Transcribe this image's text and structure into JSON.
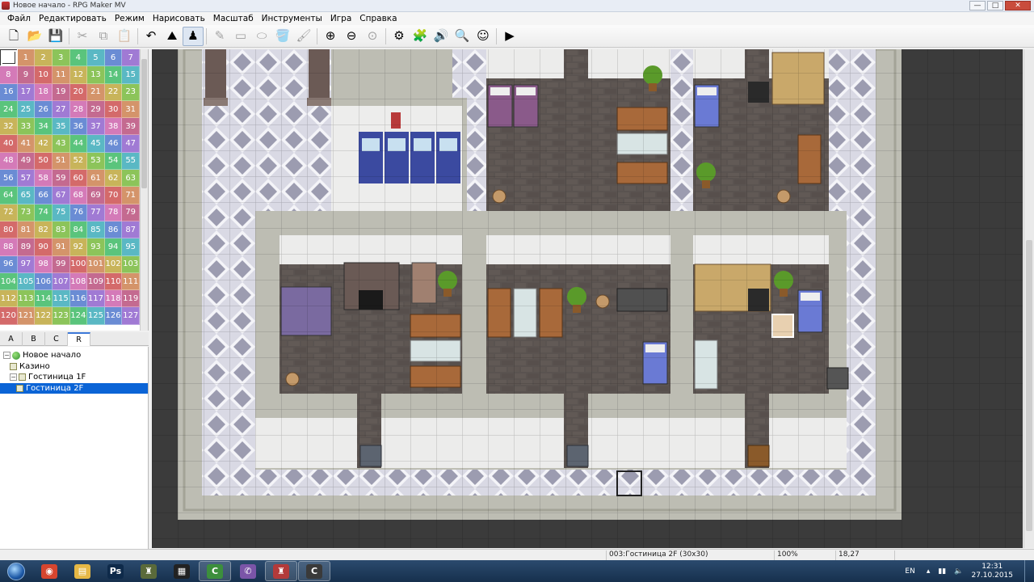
{
  "window": {
    "title": "Новое начало - RPG Maker MV",
    "minimize": "—",
    "maximize": "□",
    "close": "✕"
  },
  "menu": [
    "Файл",
    "Редактировать",
    "Режим",
    "Нарисовать",
    "Масштаб",
    "Инструменты",
    "Игра",
    "Справка"
  ],
  "toolbar": [
    {
      "name": "new-project-icon",
      "glyph": "🗋",
      "state": "normal"
    },
    {
      "name": "open-project-icon",
      "glyph": "📂",
      "state": "normal"
    },
    {
      "name": "save-project-icon",
      "glyph": "💾",
      "state": "normal"
    },
    {
      "sep": true
    },
    {
      "name": "cut-icon",
      "glyph": "✂",
      "state": "disabled"
    },
    {
      "name": "copy-icon",
      "glyph": "⧉",
      "state": "disabled"
    },
    {
      "name": "paste-icon",
      "glyph": "📋",
      "state": "disabled"
    },
    {
      "sep": true
    },
    {
      "name": "undo-icon",
      "glyph": "↶",
      "state": "normal"
    },
    {
      "name": "map-mode-icon",
      "glyph": "⛰",
      "state": "normal"
    },
    {
      "name": "event-mode-icon",
      "glyph": "♟",
      "state": "active"
    },
    {
      "sep": true
    },
    {
      "name": "pencil-icon",
      "glyph": "✎",
      "state": "disabled"
    },
    {
      "name": "rectangle-icon",
      "glyph": "▭",
      "state": "disabled"
    },
    {
      "name": "ellipse-icon",
      "glyph": "⬭",
      "state": "disabled"
    },
    {
      "name": "fill-icon",
      "glyph": "🪣",
      "state": "disabled"
    },
    {
      "name": "shadow-pen-icon",
      "glyph": "🖌",
      "state": "disabled"
    },
    {
      "sep": true
    },
    {
      "name": "zoom-in-icon",
      "glyph": "⊕",
      "state": "normal"
    },
    {
      "name": "zoom-out-icon",
      "glyph": "⊖",
      "state": "normal"
    },
    {
      "name": "actual-size-icon",
      "glyph": "⊙",
      "state": "disabled"
    },
    {
      "sep": true
    },
    {
      "name": "database-icon",
      "glyph": "⚙",
      "state": "normal"
    },
    {
      "name": "plugin-manager-icon",
      "glyph": "🧩",
      "state": "normal"
    },
    {
      "name": "sound-test-icon",
      "glyph": "🔊",
      "state": "normal"
    },
    {
      "name": "event-search-icon",
      "glyph": "🔍",
      "state": "normal"
    },
    {
      "name": "character-generator-icon",
      "glyph": "☺",
      "state": "normal"
    },
    {
      "sep": true
    },
    {
      "name": "playtest-icon",
      "glyph": "▶",
      "state": "normal"
    }
  ],
  "palette": {
    "region_ids": [
      "",
      "1",
      "2",
      "3",
      "4",
      "5",
      "6",
      "7",
      "8",
      "9",
      "10",
      "11",
      "12",
      "13",
      "14",
      "15",
      "16",
      "17",
      "18",
      "19",
      "20",
      "21",
      "22",
      "23",
      "24",
      "25",
      "26",
      "27",
      "28",
      "29",
      "30",
      "31",
      "32",
      "33",
      "34",
      "35",
      "36",
      "37",
      "38",
      "39",
      "40",
      "41",
      "42",
      "43",
      "44",
      "45",
      "46",
      "47",
      "48",
      "49",
      "50",
      "51",
      "52",
      "53",
      "54",
      "55",
      "56",
      "57",
      "58",
      "59",
      "60",
      "61",
      "62",
      "63",
      "64",
      "65",
      "66",
      "67",
      "68",
      "69",
      "70",
      "71",
      "72",
      "73",
      "74",
      "75",
      "76",
      "77",
      "78",
      "79",
      "80",
      "81",
      "82",
      "83",
      "84",
      "85",
      "86",
      "87",
      "88",
      "89",
      "90",
      "91",
      "92",
      "93",
      "94",
      "95",
      "96",
      "97",
      "98",
      "99",
      "100",
      "101",
      "102",
      "103",
      "104",
      "105",
      "106",
      "107",
      "108",
      "109",
      "110",
      "111",
      "112",
      "113",
      "114",
      "115",
      "116",
      "117",
      "118",
      "119",
      "120",
      "121",
      "122",
      "123",
      "124",
      "125",
      "126",
      "127"
    ],
    "colors": [
      "#d46a6a",
      "#d4946a",
      "#c8b45a",
      "#8cc45a",
      "#5ac47c",
      "#5ab8c4",
      "#6a8cd4",
      "#a07ad4",
      "#d47ab8",
      "#c46a90"
    ],
    "tabs": [
      "A",
      "B",
      "C",
      "R"
    ],
    "active_tab": "R"
  },
  "map_tree": [
    {
      "label": "Новое начало",
      "level": 0,
      "expander": "−",
      "kind": "project"
    },
    {
      "label": "Казино",
      "level": 1,
      "expander": "",
      "kind": "map"
    },
    {
      "label": "Гостиница 1F",
      "level": 1,
      "expander": "−",
      "kind": "map"
    },
    {
      "label": "Гостиница 2F",
      "level": 2,
      "expander": "",
      "kind": "map",
      "selected": true
    }
  ],
  "status": {
    "map_info": "003:Гостиница 2F (30x30)",
    "zoom": "100%",
    "coords": "18,27"
  },
  "taskbar": {
    "apps": [
      {
        "name": "chrome-taskbar-icon",
        "glyph": "◉",
        "color": "#d6452f",
        "running": false
      },
      {
        "name": "explorer-taskbar-icon",
        "glyph": "▤",
        "color": "#e6b845",
        "running": false
      },
      {
        "name": "photoshop-taskbar-icon",
        "glyph": "Ps",
        "color": "#0e2a4a",
        "running": false
      },
      {
        "name": "rpgmaker-vx-taskbar-icon",
        "glyph": "♜",
        "color": "#5a6a3a",
        "running": false
      },
      {
        "name": "video-editor-taskbar-icon",
        "glyph": "▦",
        "color": "#222222",
        "running": false
      },
      {
        "name": "camtasia-taskbar-icon",
        "glyph": "C",
        "color": "#3c8f3c",
        "running": true
      },
      {
        "name": "viber-taskbar-icon",
        "glyph": "✆",
        "color": "#7b55a8",
        "running": false
      },
      {
        "name": "rpgmaker-mv-taskbar-icon",
        "glyph": "♜",
        "color": "#b33a3a",
        "running": true
      },
      {
        "name": "camtasia-recorder-taskbar-icon",
        "glyph": "C",
        "color": "#3a3a3a",
        "running": true
      }
    ],
    "language": "EN",
    "time": "12:31",
    "date": "27.10.2015"
  }
}
